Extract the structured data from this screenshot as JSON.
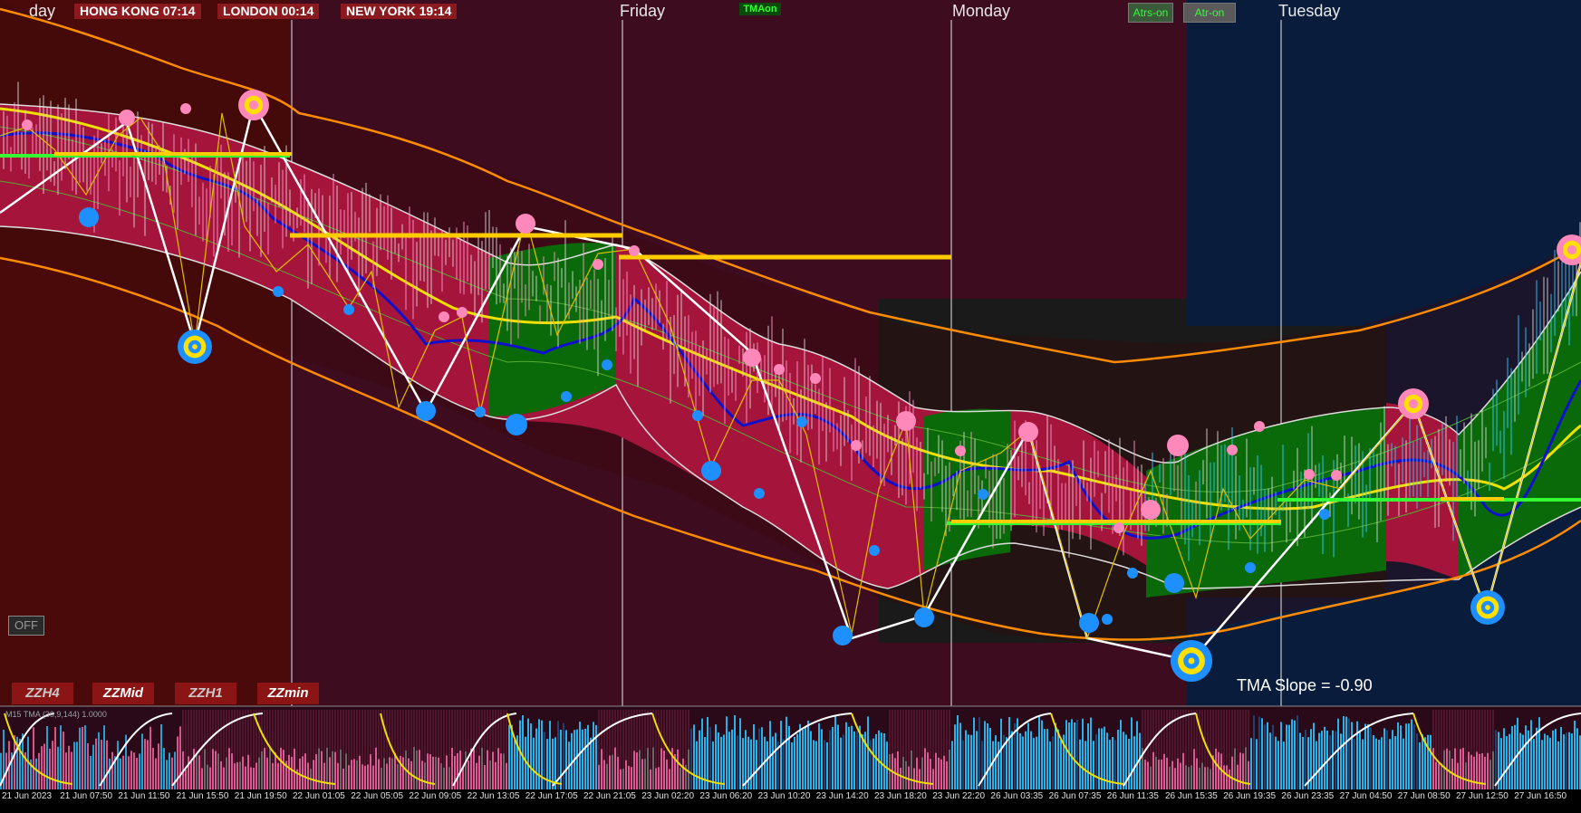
{
  "clocks": [
    {
      "label": "HONG KONG 07:14"
    },
    {
      "label": "LONDON  00:14"
    },
    {
      "label": "NEW YORK  19:14"
    }
  ],
  "day_labels": [
    "day",
    "Friday",
    "Monday",
    "Tuesday"
  ],
  "buttons": {
    "tma_on": "TMAon",
    "atrs_on": "Atrs-on",
    "atr_on": "Atr-on",
    "off": "OFF",
    "zz": [
      "ZZH4",
      "ZZMid",
      "ZZH1",
      "ZZmin"
    ]
  },
  "tma_slope_text": "TMA Slope = -0.90",
  "indicator_title": "M15 TMA (30,9,144) 1.0000",
  "colors": {
    "upper_bg": "#4a0a0a",
    "plum_bg": "#3d0c1e",
    "dark_bg": "#1a1a1a",
    "navy_bg": "#0a1c3c",
    "band_red": "#a5143a",
    "band_green": "#0a6a0a",
    "orange_band": "#ff8c00",
    "blue_line": "#1010cc",
    "yellow_line": "#f0e000",
    "level_yellow": "#ffcc00",
    "level_green": "#33ff33",
    "swing_high": "#ff88bb",
    "swing_low": "#1e8fff"
  },
  "chart_data": {
    "type": "line",
    "time_labels": [
      "21 Jun 2023",
      "21 Jun 07:50",
      "21 Jun 11:50",
      "21 Jun 15:50",
      "21 Jun 19:50",
      "22 Jun 01:05",
      "22 Jun 05:05",
      "22 Jun 09:05",
      "22 Jun 13:05",
      "22 Jun 17:05",
      "22 Jun 21:05",
      "23 Jun 02:20",
      "23 Jun 06:20",
      "23 Jun 10:20",
      "23 Jun 14:20",
      "23 Jun 18:20",
      "23 Jun 22:20",
      "26 Jun 03:35",
      "26 Jun 07:35",
      "26 Jun 11:35",
      "26 Jun 15:35",
      "26 Jun 19:35",
      "26 Jun 23:35",
      "27 Jun 04:50",
      "27 Jun 08:50",
      "27 Jun 12:50",
      "27 Jun 16:50"
    ],
    "grid": false,
    "legend": "none"
  }
}
